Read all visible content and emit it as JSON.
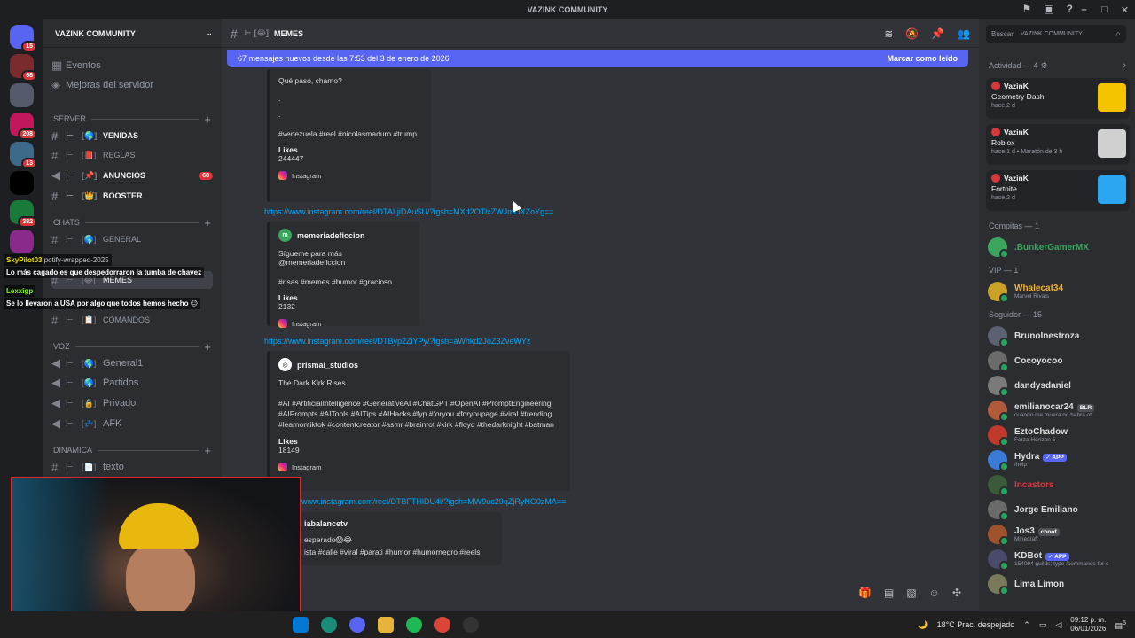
{
  "window": {
    "title": "VAZINK COMMUNITY",
    "title_icon": "diamond-icon"
  },
  "guilds": [
    {
      "color": "#5865f2",
      "badge": "15"
    },
    {
      "color": "#7a2b2b",
      "badge": "68"
    },
    {
      "color": "#555a6a",
      "badge": ""
    },
    {
      "color": "#c2185b",
      "badge": "208"
    },
    {
      "color": "#3d6a8a",
      "badge": "13"
    },
    {
      "color": "#000000",
      "badge": ""
    },
    {
      "color": "#1a7a3a",
      "badge": "382"
    },
    {
      "color": "#8a2a8a",
      "badge": ""
    }
  ],
  "server": {
    "name": "VAZINK COMMUNITY",
    "events_label": "Eventos",
    "boosts_label": "Mejoras del servidor",
    "categories": {
      "server": "SERVER",
      "chats": "CHATS",
      "voz": "VOZ",
      "dinamica": "DINAMICA"
    },
    "channels": {
      "venidas": "VENIDAS",
      "reglas": "REGLAS",
      "anuncios": "ANUNCIOS",
      "anuncios_badge": "68",
      "booster": "BOOSTER",
      "general": "GENERAL",
      "memes": "MEMES",
      "comandos": "COMANDOS",
      "general1": "General1",
      "partidos": "Partidos",
      "privado": "Privado",
      "afk": "AFK",
      "texto": "texto"
    }
  },
  "chat_header": {
    "channel": "MEMES"
  },
  "banner": {
    "text": "67 mensajes nuevos desde las 7:53 del 3 de enero de 2026",
    "action": "Marcar como leído"
  },
  "messages": [
    {
      "description": "Qué pasó, chamo?",
      "dots": [
        ".",
        "."
      ],
      "tags": "#venezuela #reel #nicolasmaduro #trump",
      "field": "Likes",
      "likes": "244447",
      "footer": "Instagram"
    },
    {
      "link": "https://www.instagram.com/reel/DTALjiDAuSU/?igsh=MXd2OTlxZWJmOXZoYg==",
      "author": "memeriadeficcion",
      "description": "Sígueme para más @memeriadeficcion",
      "tags": "#risas #memes #humor #gracioso",
      "field": "Likes",
      "likes": "2132",
      "footer": "Instagram"
    },
    {
      "link": "https://www.instagram.com/reel/DTByp2ZiYPy/?igsh=aWhkd2JoZ3ZveWYz",
      "author": "prismai_studios",
      "description": "The Dark Kirk Rises",
      "tags": "#AI #ArtificialIntelligence #GenerativeAI #ChatGPT #OpenAI #PromptEngineering #AIPrompts #AITools #AITips #AIHacks #fyp #foryou #foryoupage #viral #trending #learnontiktok #contentcreator #asmr #brainrot #kirk #floyd #thedarknight #batman",
      "field": "Likes",
      "likes": "18149",
      "footer": "Instagram"
    },
    {
      "link": "www.instagram.com/reel/DTBFTHlDU4i/?igsh=MW9uc29qZjRyNG0zMA==",
      "author": "iabalancetv",
      "description": "esperado😱😂",
      "tags": "ista #calle #viral #parati #humor #humornegro #reels"
    }
  ],
  "stream_chat": [
    {
      "user": "SkyPilot03",
      "text": "Lo más cagado es que despedorraron la tumba de chavez"
    },
    {
      "user": "Lexxigp",
      "text": "Se lo llevaron a USA por algo que todos hemos hecho 😐"
    }
  ],
  "stream_overlay_text": "potify-wrapped-2025",
  "members": {
    "search_placeholder": "Buscar",
    "search_tag": "VAZINK COMMUNITY",
    "activity_header": "Actividad — 4",
    "activities": [
      {
        "name": "VazinK",
        "game": "Geometry Dash",
        "meta": "hace 2 d",
        "thumb_color": "#f5c400"
      },
      {
        "name": "VazinK",
        "game": "Roblox",
        "meta": "hace 1 d  •  Maratón de 3 h",
        "thumb_color": "#d0d0d0"
      },
      {
        "name": "VazinK",
        "game": "Fortnite",
        "meta": "hace 2 d",
        "thumb_color": "#2aa7f0"
      }
    ],
    "groups": [
      {
        "header": "Compitas — 1",
        "members": [
          {
            "name": ".BunkerGamerMX",
            "sub": "",
            "color": "#3ba55d",
            "name_color": "#3ba55d"
          }
        ]
      },
      {
        "header": "VIP — 1",
        "members": [
          {
            "name": "Whalecat34",
            "sub": "Marvel Rivals",
            "color": "#c9a227",
            "name_color": "#f0b232"
          }
        ]
      },
      {
        "header": "Seguidor — 15",
        "members": [
          {
            "name": "BrunoInestroza",
            "sub": "",
            "color": "#5b6170"
          },
          {
            "name": "Cocoyocoo",
            "sub": "",
            "color": "#6b6b6b"
          },
          {
            "name": "dandysdaniel",
            "sub": "",
            "color": "#7a7a7a"
          },
          {
            "name": "emilianocar24",
            "sub": "cuando me muera no habrá ot",
            "color": "#b05a3a",
            "tag": "BLR"
          },
          {
            "name": "EztoChadow",
            "sub": "Forza Horizon 5",
            "color": "#c0392b"
          },
          {
            "name": "Hydra",
            "sub": "/help",
            "color": "#3a7bd5",
            "tag_app": "APP"
          },
          {
            "name": "Incastors",
            "sub": "",
            "color": "#3a5a3a",
            "name_color": "#da373c"
          },
          {
            "name": "Jorge Emiliano",
            "sub": "",
            "color": "#6a6a6a"
          },
          {
            "name": "Jos3",
            "sub": "Minecraft",
            "color": "#a0522d",
            "tag": "choof"
          },
          {
            "name": "KDBot",
            "sub": "154094 guilds; type /commands for c",
            "color": "#4a4a6a",
            "tag_app": "APP"
          },
          {
            "name": "Lima Limon",
            "sub": "",
            "color": "#7a7a5a"
          }
        ]
      }
    ]
  },
  "taskbar": {
    "weather": "18°C  Prac. despejado",
    "time": "09:12 p. m.",
    "date": "06/01/2026",
    "notif_badge": "5"
  },
  "colors": {
    "accent": "#5865f2",
    "link": "#00a8fc",
    "danger": "#da373c"
  }
}
